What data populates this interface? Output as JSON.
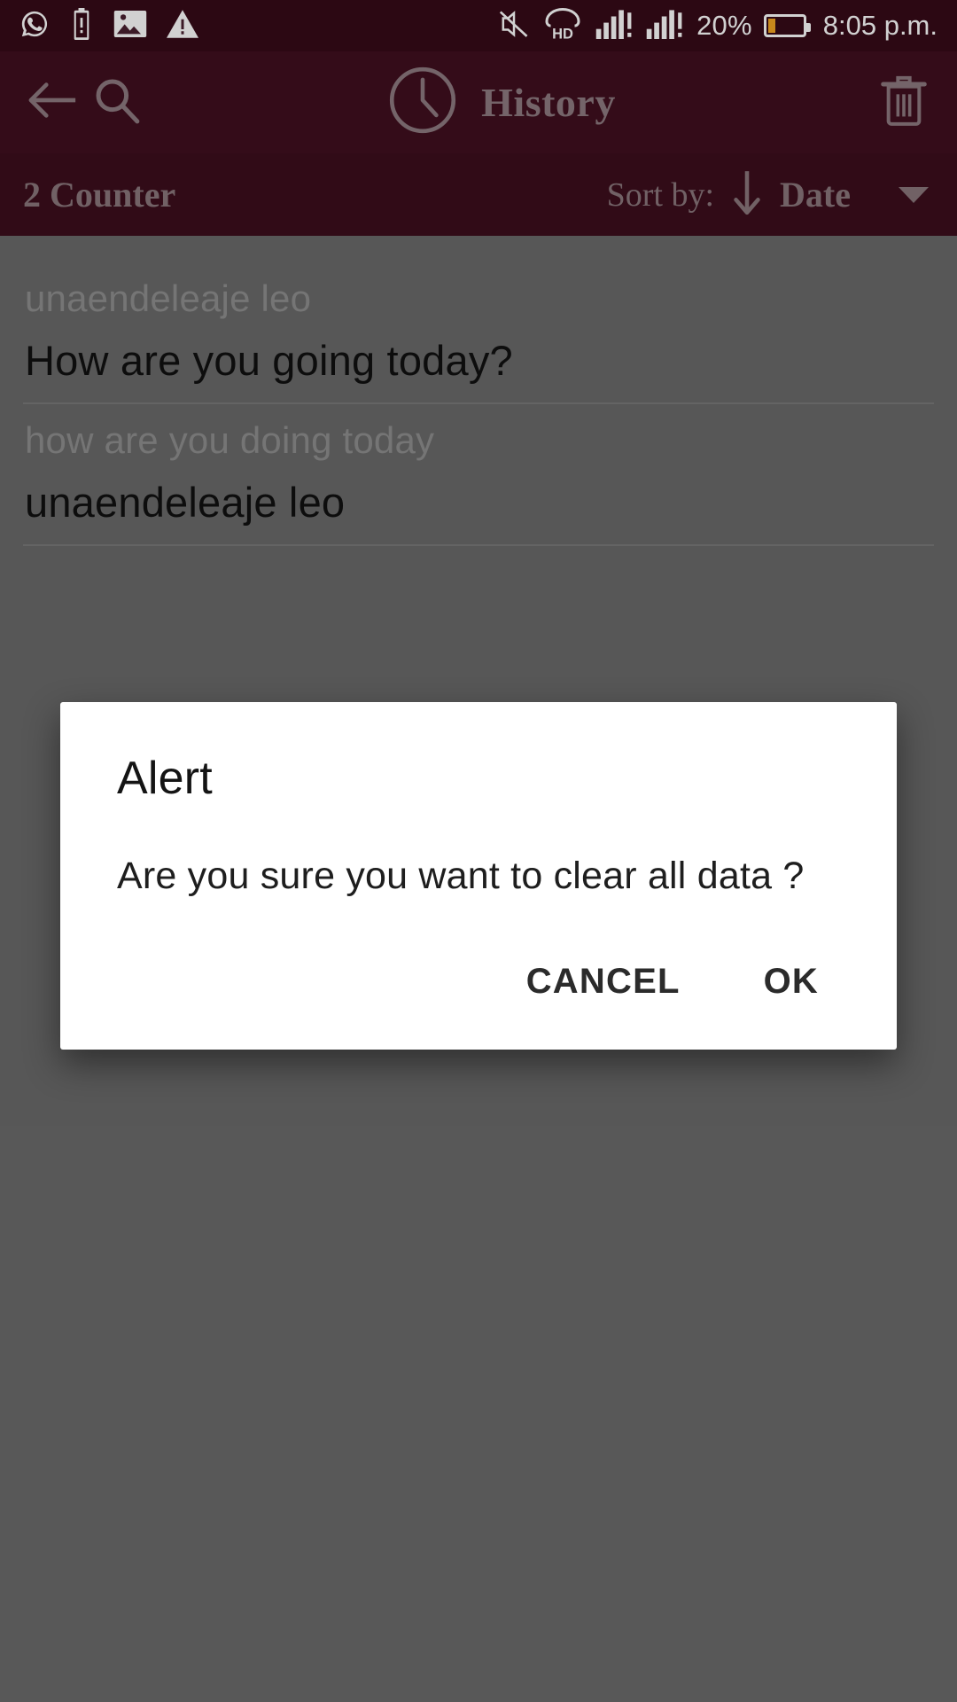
{
  "status_bar": {
    "left_icons": [
      {
        "name": "whatsapp-icon",
        "glyph": "whatsapp"
      },
      {
        "name": "battery-alert-icon",
        "glyph": "battery-alert"
      },
      {
        "name": "image-icon",
        "glyph": "image"
      },
      {
        "name": "warning-icon",
        "glyph": "warning"
      }
    ],
    "mute_icon": "mute-icon",
    "hd_label": "HD",
    "signal_1": "signal-bars-icon",
    "signal_2": "signal-bars-icon",
    "battery_percent": "20%",
    "battery_level": 20,
    "time": "8:05 p.m."
  },
  "toolbar": {
    "back_icon": "back-arrow-icon",
    "search_icon": "search-icon",
    "clock_icon": "clock-icon",
    "title": "History",
    "delete_icon": "trash-icon"
  },
  "subbar": {
    "counter": "2 Counter",
    "sort_label": "Sort by:",
    "sort_direction_icon": "arrow-down-icon",
    "sort_value": "Date",
    "dropdown_icon": "chevron-down-icon"
  },
  "history_list": [
    {
      "source_text": "unaendeleaje leo",
      "translated_text": "How are you going today?"
    },
    {
      "source_text": "how are you doing today",
      "translated_text": "unaendeleaje leo"
    }
  ],
  "dialog": {
    "title": "Alert",
    "message": "Are you sure you want to clear all data ?",
    "cancel_label": "CANCEL",
    "ok_label": "OK"
  },
  "colors": {
    "status_bar_bg": "#360a18",
    "toolbar_bg": "#400f1f",
    "subbar_bg": "#3c0e1d",
    "toolbar_fg": "#8e7b80",
    "list_bg": "#6b6b6b",
    "battery_accent": "#f5a623",
    "dialog_bg": "#ffffff"
  }
}
